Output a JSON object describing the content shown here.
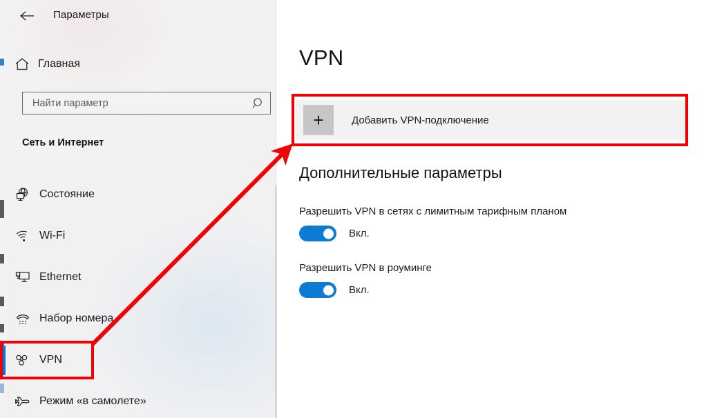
{
  "window": {
    "app_title": "Параметры",
    "back_icon": "back-arrow-icon"
  },
  "sidebar": {
    "home_label": "Главная",
    "home_icon": "home-icon",
    "search": {
      "placeholder": "Найти параметр",
      "value": "",
      "icon": "search-icon"
    },
    "section_title": "Сеть и Интернет",
    "items": [
      {
        "label": "Состояние",
        "icon": "network-status-icon",
        "selected": false
      },
      {
        "label": "Wi-Fi",
        "icon": "wifi-icon",
        "selected": false
      },
      {
        "label": "Ethernet",
        "icon": "ethernet-icon",
        "selected": false
      },
      {
        "label": "Набор номера",
        "icon": "dial-up-phone-icon",
        "selected": false
      },
      {
        "label": "VPN",
        "icon": "vpn-key-icon",
        "selected": true
      },
      {
        "label": "Режим «в самолете»",
        "icon": "airplane-icon",
        "selected": false
      }
    ]
  },
  "main": {
    "page_title": "VPN",
    "add_connection": {
      "label": "Добавить VPN-подключение",
      "icon": "plus-icon"
    },
    "advanced_heading": "Дополнительные параметры",
    "settings": [
      {
        "caption": "Разрешить VPN в сетях с лимитным тарифным планом",
        "state": "Вкл."
      },
      {
        "caption": "Разрешить VPN в роуминге",
        "state": "Вкл."
      }
    ]
  },
  "annotations": {
    "highlight_color": "#f40000",
    "accent_color": "#0078d7",
    "toggle_on_color": "#0b7bd4",
    "boxes": [
      "add-vpn-connection-button",
      "sidebar-item-vpn"
    ],
    "arrow": "points from VPN sidebar item to Add VPN connection button"
  }
}
